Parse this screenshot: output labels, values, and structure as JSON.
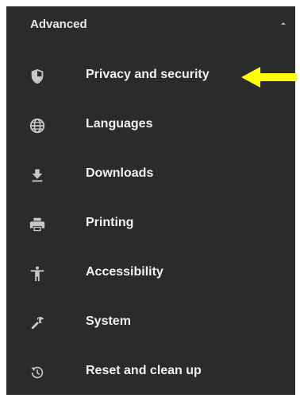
{
  "section": {
    "title": "Advanced"
  },
  "items": [
    {
      "label": "Privacy and security",
      "icon": "shield-icon"
    },
    {
      "label": "Languages",
      "icon": "globe-icon"
    },
    {
      "label": "Downloads",
      "icon": "download-icon"
    },
    {
      "label": "Printing",
      "icon": "printer-icon"
    },
    {
      "label": "Accessibility",
      "icon": "accessibility-icon"
    },
    {
      "label": "System",
      "icon": "wrench-icon"
    },
    {
      "label": "Reset and clean up",
      "icon": "reset-icon"
    }
  ],
  "colors": {
    "panel_background": "#2b2b2b",
    "text": "#f0f0f0",
    "icon": "#c8c8c8",
    "annotation_arrow": "#ffff00"
  }
}
